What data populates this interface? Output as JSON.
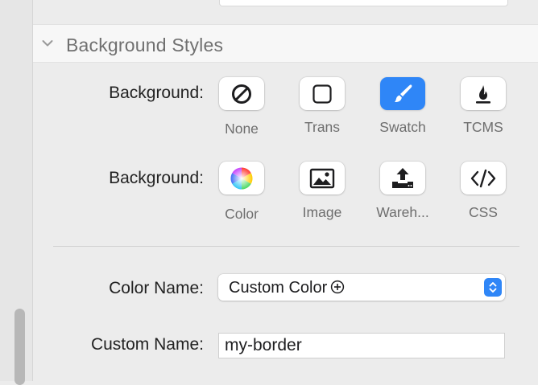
{
  "section": {
    "title": "Background Styles",
    "expanded": true
  },
  "background_type": {
    "label": "Background:",
    "options": [
      {
        "label": "None",
        "icon": "no-symbol-icon",
        "selected": false
      },
      {
        "label": "Trans",
        "icon": "square-outline-icon",
        "selected": false
      },
      {
        "label": "Swatch",
        "icon": "paintbrush-icon",
        "selected": true
      },
      {
        "label": "TCMS",
        "icon": "flame-icon",
        "selected": false
      }
    ]
  },
  "background_source": {
    "label": "Background:",
    "options": [
      {
        "label": "Color",
        "icon": "color-wheel-icon"
      },
      {
        "label": "Image",
        "icon": "image-icon"
      },
      {
        "label": "Wareh...",
        "icon": "upload-tray-icon"
      },
      {
        "label": "CSS",
        "icon": "code-icon"
      }
    ]
  },
  "color_name": {
    "label": "Color Name:",
    "value": "Custom Color"
  },
  "custom_name": {
    "label": "Custom Name:",
    "value": "my-border"
  },
  "colors": {
    "accent": "#2f86f7",
    "panel": "#ececec",
    "header": "#f7f7f7"
  }
}
